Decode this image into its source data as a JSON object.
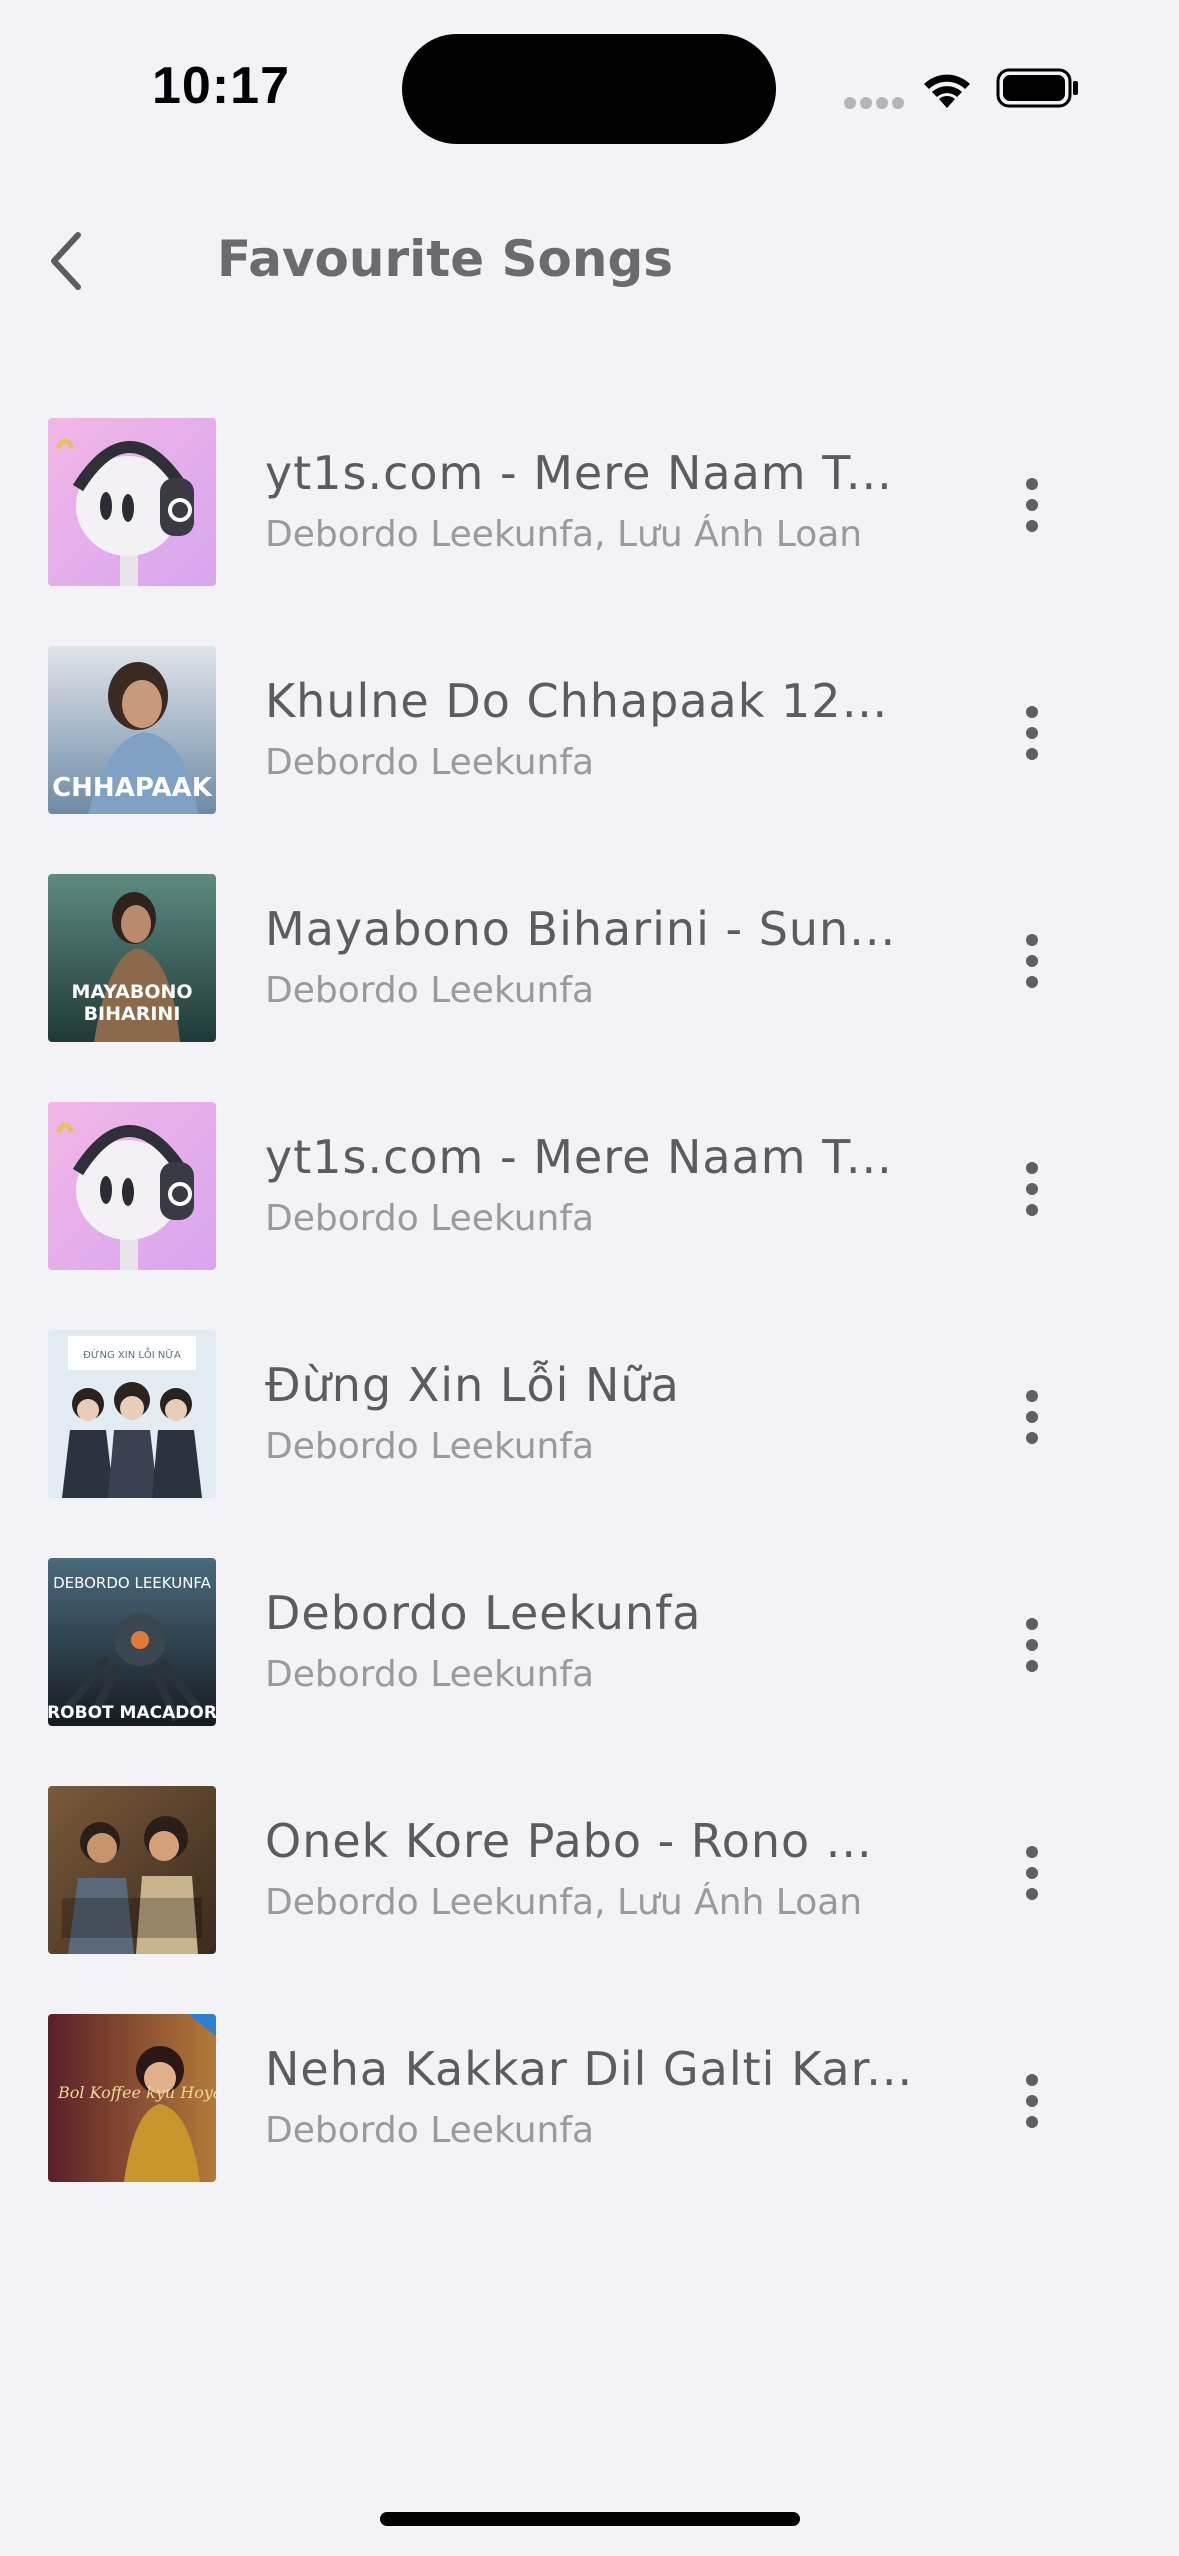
{
  "status_bar": {
    "time": "10:17"
  },
  "header": {
    "title": "Favourite Songs"
  },
  "songs": [
    {
      "title": "yt1s.com - Mere Naam T...",
      "artist": "Debordo Leekunfa, Lưu Ánh Loan",
      "art": "headphone-mascot"
    },
    {
      "title": "Khulne Do Chhapaak 128...",
      "artist": "Debordo Leekunfa",
      "art": "chhapaak",
      "art_text": "CHHAPAAK"
    },
    {
      "title": "Mayabono Biharini - Sun...",
      "artist": "Debordo Leekunfa",
      "art": "mayabono",
      "art_text": "MAYABONO BIHARINI"
    },
    {
      "title": "yt1s.com - Mere Naam T...",
      "artist": "Debordo Leekunfa",
      "art": "headphone-mascot"
    },
    {
      "title": "Đừng Xin Lỗi Nữa",
      "artist": "Debordo Leekunfa",
      "art": "dung-xin-loi-nua",
      "art_text": "ĐỪNG XIN LỖI NỮA"
    },
    {
      "title": "Debordo Leekunfa",
      "artist": "Debordo Leekunfa",
      "art": "robot-macador",
      "art_text": "DEBORDO LEEKUNFA",
      "art_text2": "ROBOT MACADOR"
    },
    {
      "title": "Onek Kore Pabo - Rono ...",
      "artist": "Debordo Leekunfa, Lưu Ánh Loan",
      "art": "onek-kore-pabo"
    },
    {
      "title": "Neha Kakkar Dil Galti Kar...",
      "artist": "Debordo Leekunfa",
      "art": "neha-kakkar",
      "art_text": "Bol Koffee kyu Hoya"
    }
  ],
  "colors": {
    "background": "#f2f2f7",
    "title_text": "#5c5c60",
    "artist_text": "#9a9a9e"
  }
}
